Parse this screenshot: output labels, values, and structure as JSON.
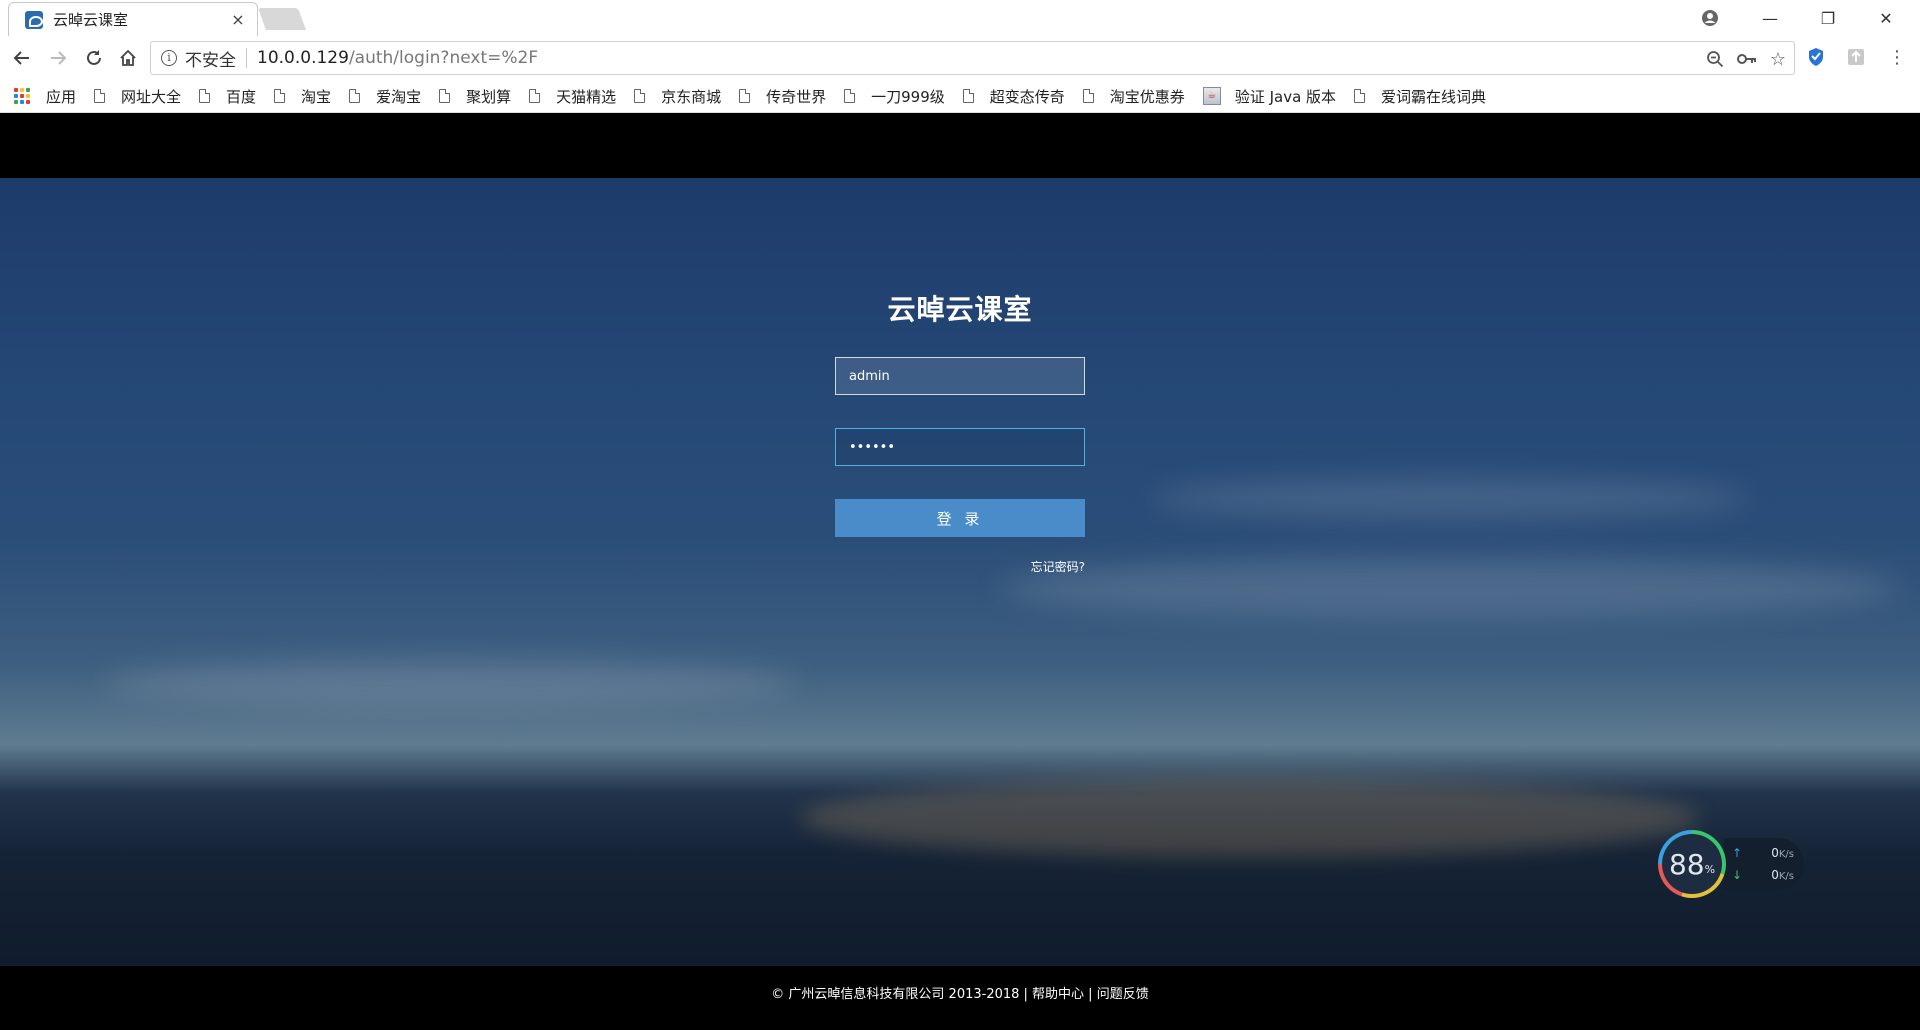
{
  "browser": {
    "tab_title": "云晫云课室",
    "tab_close": "×",
    "security_label": "不安全",
    "url_host": "10.0.0.129",
    "url_path": "/auth/login?next=%2F",
    "window_controls": {
      "minimize": "—",
      "restore": "❐",
      "close": "✕"
    }
  },
  "bookmarks": [
    {
      "label": "应用",
      "icon": "apps-grid-icon"
    },
    {
      "label": "网址大全",
      "icon": "page-icon"
    },
    {
      "label": "百度",
      "icon": "page-icon"
    },
    {
      "label": "淘宝",
      "icon": "page-icon"
    },
    {
      "label": "爱淘宝",
      "icon": "page-icon"
    },
    {
      "label": "聚划算",
      "icon": "page-icon"
    },
    {
      "label": "天猫精选",
      "icon": "page-icon"
    },
    {
      "label": "京东商城",
      "icon": "page-icon"
    },
    {
      "label": "传奇世界",
      "icon": "page-icon"
    },
    {
      "label": "一刀999级",
      "icon": "page-icon"
    },
    {
      "label": "超变态传奇",
      "icon": "page-icon"
    },
    {
      "label": "淘宝优惠券",
      "icon": "page-icon"
    },
    {
      "label": "验证 Java 版本",
      "icon": "java-icon"
    },
    {
      "label": "爱词霸在线词典",
      "icon": "page-icon"
    }
  ],
  "login": {
    "title": "云晫云课室",
    "username_value": "admin",
    "password_value": "••••••",
    "submit_label": "登 录",
    "forgot_label": "忘记密码?"
  },
  "footer": {
    "text": "© 广州云晫信息科技有限公司 2013-2018 | 帮助中心 | 问题反馈"
  },
  "net_monitor": {
    "percent": "88",
    "percent_unit": "%",
    "upload": "0",
    "download": "0",
    "unit": "K/s"
  },
  "colors": {
    "accent_button": "#4a8bc9",
    "focus_border": "#4fb3d9",
    "page_background": "#000000"
  }
}
